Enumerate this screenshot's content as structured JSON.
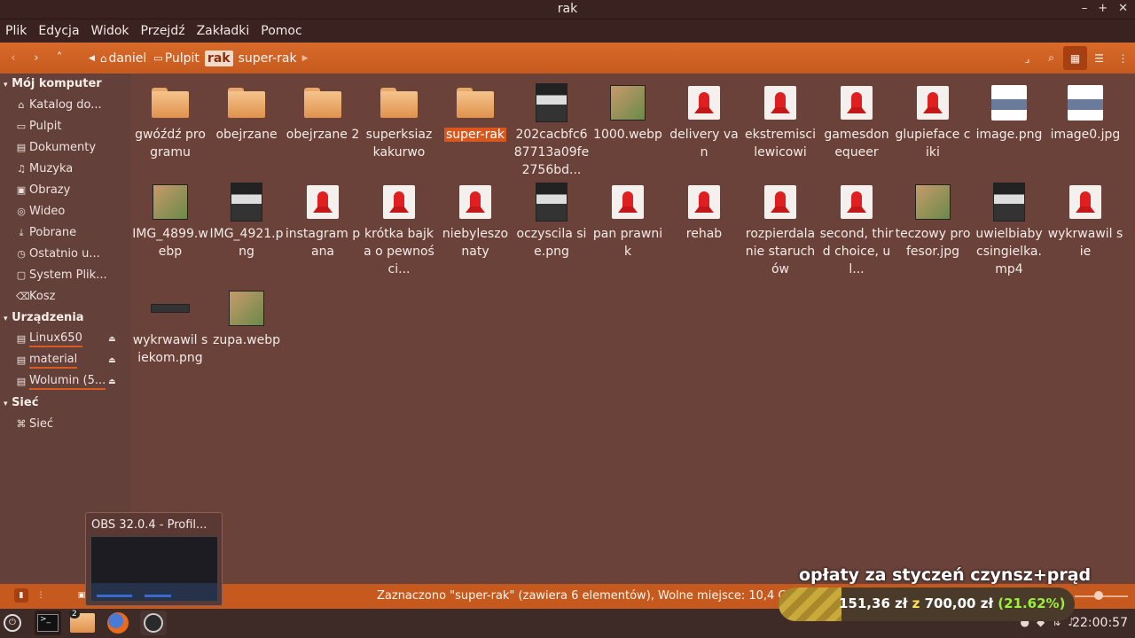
{
  "window": {
    "title": "rak"
  },
  "menu": [
    "Plik",
    "Edycja",
    "Widok",
    "Przejdź",
    "Zakładki",
    "Pomoc"
  ],
  "breadcrumb": [
    "daniel",
    "Pulpit",
    "rak",
    "super-rak"
  ],
  "breadcrumb_active": "rak",
  "sidebar": {
    "sections": [
      {
        "title": "Mój komputer",
        "items": [
          {
            "label": "Katalog do...",
            "icon": "home-icon"
          },
          {
            "label": "Pulpit",
            "icon": "desktop-icon"
          },
          {
            "label": "Dokumenty",
            "icon": "documents-icon"
          },
          {
            "label": "Muzyka",
            "icon": "music-icon"
          },
          {
            "label": "Obrazy",
            "icon": "pictures-icon"
          },
          {
            "label": "Wideo",
            "icon": "video-icon"
          },
          {
            "label": "Pobrane",
            "icon": "download-icon"
          },
          {
            "label": "Ostatnio u...",
            "icon": "recent-icon"
          },
          {
            "label": "System Plik...",
            "icon": "drive-icon"
          },
          {
            "label": "Kosz",
            "icon": "trash-icon"
          }
        ]
      },
      {
        "title": "Urządzenia",
        "items": [
          {
            "label": "Linux650",
            "icon": "drive-icon"
          },
          {
            "label": "material",
            "icon": "drive-icon"
          },
          {
            "label": "Wolumin (5...",
            "icon": "drive-icon"
          }
        ]
      },
      {
        "title": "Sieć",
        "items": [
          {
            "label": "Sieć",
            "icon": "network-icon"
          }
        ]
      }
    ]
  },
  "files": [
    {
      "name": "gwóźdź programu",
      "kind": "folder"
    },
    {
      "name": "obejrzane",
      "kind": "folder"
    },
    {
      "name": "obejrzane 2",
      "kind": "folder"
    },
    {
      "name": "superksiaz kakurwo",
      "kind": "folder"
    },
    {
      "name": "super-rak",
      "kind": "folder",
      "selected": true
    },
    {
      "name": "202cacbfc687713a09fe2756bd...",
      "kind": "image-dark"
    },
    {
      "name": "1000.webp",
      "kind": "image-photo"
    },
    {
      "name": "delivery van",
      "kind": "rocket"
    },
    {
      "name": "ekstremisci lewicowi",
      "kind": "rocket"
    },
    {
      "name": "gamesdon equeer",
      "kind": "rocket"
    },
    {
      "name": "glupieface ciki",
      "kind": "rocket"
    },
    {
      "name": "image.png",
      "kind": "image-doc"
    },
    {
      "name": "image0.jpg",
      "kind": "image-doc"
    },
    {
      "name": "IMG_4899.webp",
      "kind": "image-photo"
    },
    {
      "name": "IMG_4921.png",
      "kind": "image-dark"
    },
    {
      "name": "instagram pana",
      "kind": "rocket"
    },
    {
      "name": "krótka bajka o pewności...",
      "kind": "rocket"
    },
    {
      "name": "niebyleszo naty",
      "kind": "rocket"
    },
    {
      "name": "oczyscila sie.png",
      "kind": "image-dark"
    },
    {
      "name": "pan prawnik",
      "kind": "rocket"
    },
    {
      "name": "rehab",
      "kind": "rocket"
    },
    {
      "name": "rozpierdala nie staruchów",
      "kind": "rocket"
    },
    {
      "name": "second, third choice, ul...",
      "kind": "rocket"
    },
    {
      "name": "teczowy profesor.jpg",
      "kind": "image-photo"
    },
    {
      "name": "uwielbiaby csingielka.mp4",
      "kind": "image-dark"
    },
    {
      "name": "wykrwawil sie",
      "kind": "rocket"
    },
    {
      "name": "wykrwawil siekom.png",
      "kind": "image-strip"
    },
    {
      "name": "zupa.webp",
      "kind": "image-photo"
    }
  ],
  "status": {
    "text": "Zaznaczono \"super-rak\" (zawiera 6 elementów), Wolne miejsce: 10,4 GB"
  },
  "taskbar": {
    "clock": "22:00:57",
    "badge": "2"
  },
  "obs_popup": {
    "title": "OBS 32.0.4 - Profil..."
  },
  "donation": {
    "title": "opłaty za styczeń czynsz+prąd",
    "current": "151,36 zł",
    "sep": "z",
    "goal": "700,00 zł",
    "percent_label": "(21.62%)",
    "fraction": 0.2162
  },
  "colors": {
    "accent": "#c65a1e",
    "background": "#6a4239",
    "sidebar": "#63403a"
  }
}
